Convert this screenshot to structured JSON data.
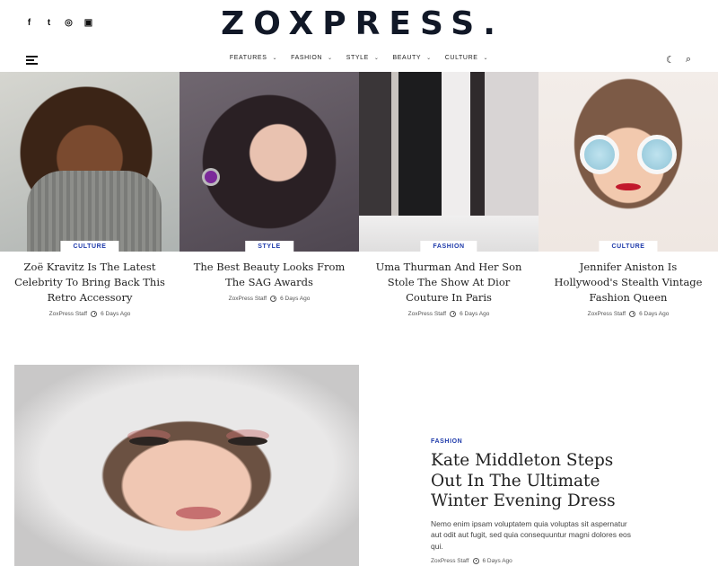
{
  "site": {
    "logo": "ZOXPRESS."
  },
  "social": [
    {
      "icon": "facebook-icon",
      "glyph": "f"
    },
    {
      "icon": "twitter-icon",
      "glyph": "t"
    },
    {
      "icon": "instagram-icon",
      "glyph": "◎"
    },
    {
      "icon": "flipboard-icon",
      "glyph": "▣"
    }
  ],
  "nav": {
    "items": [
      {
        "label": "FEATURES"
      },
      {
        "label": "FASHION"
      },
      {
        "label": "STYLE"
      },
      {
        "label": "BEAUTY"
      },
      {
        "label": "CULTURE"
      }
    ],
    "dark_mode_icon": "☾",
    "search_icon": "⌕"
  },
  "grid": [
    {
      "category": "CULTURE",
      "title": "Zoë Kravitz Is The Latest Celebrity To Bring Back This Retro Accessory",
      "author": "ZoxPress Staff",
      "time": "6 Days Ago"
    },
    {
      "category": "STYLE",
      "title": "The Best Beauty Looks From The SAG Awards",
      "author": "ZoxPress Staff",
      "time": "6 Days Ago"
    },
    {
      "category": "FASHION",
      "title": "Uma Thurman And Her Son Stole The Show At Dior Couture In Paris",
      "author": "ZoxPress Staff",
      "time": "6 Days Ago"
    },
    {
      "category": "CULTURE",
      "title": "Jennifer Aniston Is Hollywood's Stealth Vintage Fashion Queen",
      "author": "ZoxPress Staff",
      "time": "6 Days Ago"
    }
  ],
  "feature": {
    "category": "FASHION",
    "title": "Kate Middleton Steps Out In The Ultimate Winter Evening Dress",
    "excerpt": "Nemo enim ipsam voluptatem quia voluptas sit aspernatur aut odit aut fugit, sed quia consequuntur magni dolores eos qui.",
    "author": "ZoxPress Staff",
    "time": "6 Days Ago"
  },
  "colors": {
    "accent": "#1e3aaa",
    "logo": "#111827"
  }
}
